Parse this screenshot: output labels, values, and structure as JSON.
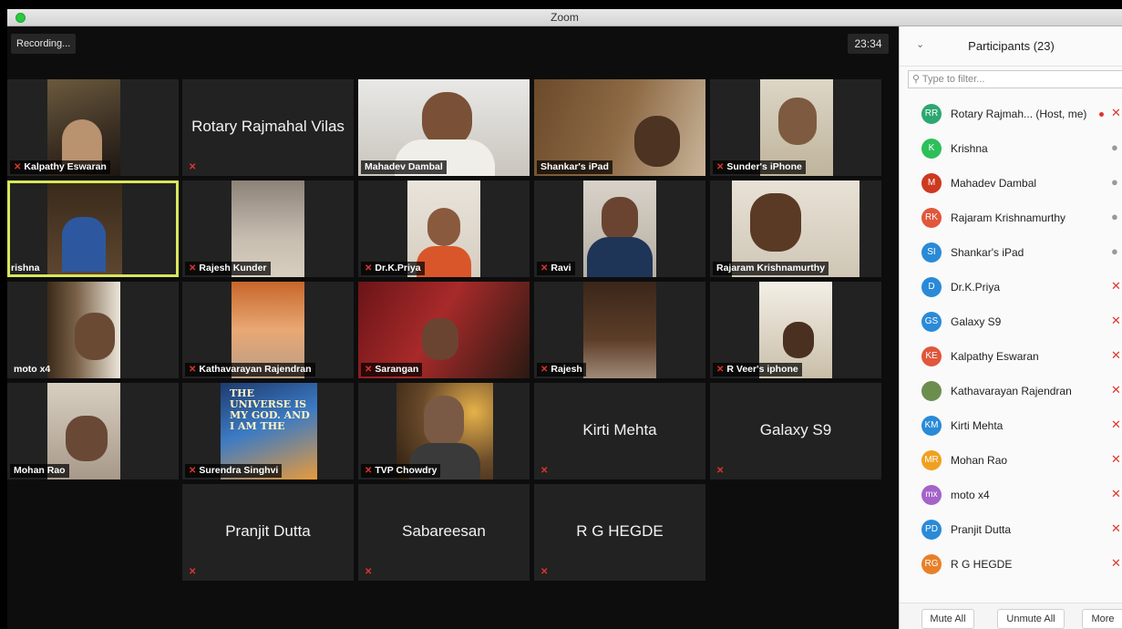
{
  "window": {
    "title": "Zoom"
  },
  "stage": {
    "recording": "Recording...",
    "timer": "23:34"
  },
  "tiles": [
    {
      "name": "Kalpathy Eswaran"
    },
    {
      "name": "Rotary Rajmahal Vilas"
    },
    {
      "name": "Mahadev Dambal"
    },
    {
      "name": "Shankar's iPad"
    },
    {
      "name": "Sunder's iPhone"
    },
    {
      "name": "rishna"
    },
    {
      "name": "Rajesh Kunder"
    },
    {
      "name": "Dr.K.Priya"
    },
    {
      "name": "Ravi"
    },
    {
      "name": "Rajaram Krishnamurthy"
    },
    {
      "name": "moto x4"
    },
    {
      "name": "Kathavarayan Rajendran"
    },
    {
      "name": "Sarangan"
    },
    {
      "name": "Rajesh"
    },
    {
      "name": "R Veer's iphone"
    },
    {
      "name": "Mohan Rao"
    },
    {
      "name": "Surendra Singhvi"
    },
    {
      "name": "TVP Chowdry"
    },
    {
      "name": "Kirti Mehta"
    },
    {
      "name": "Galaxy S9"
    },
    {
      "name": "Pranjit Dutta"
    },
    {
      "name": "Sabareesan"
    },
    {
      "name": "R G HEGDE"
    }
  ],
  "poster_text": "THE UNIVERSE IS MY GOD. AND I AM THE",
  "panel": {
    "title": "Participants (23)",
    "filter_placeholder": "Type to filter...",
    "participants": [
      {
        "initials": "RR",
        "name": "Rotary Rajmah...  (Host, me)",
        "color": "#2da771",
        "mic": "muted"
      },
      {
        "initials": "K",
        "name": "Krishna",
        "color": "#2dbf5a",
        "mic": "on"
      },
      {
        "initials": "M",
        "name": "Mahadev Dambal",
        "color": "#cc3a1f",
        "mic": "on"
      },
      {
        "initials": "RK",
        "name": "Rajaram Krishnamurthy",
        "color": "#e0573b",
        "mic": "on"
      },
      {
        "initials": "SI",
        "name": "Shankar's iPad",
        "color": "#2a8ad7",
        "mic": "on"
      },
      {
        "initials": "D",
        "name": "Dr.K.Priya",
        "color": "#2a8ad7",
        "mic": "muted"
      },
      {
        "initials": "GS",
        "name": "Galaxy S9",
        "color": "#2a8ad7",
        "mic": "muted"
      },
      {
        "initials": "KE",
        "name": "Kalpathy Eswaran",
        "color": "#e0573b",
        "mic": "muted"
      },
      {
        "initials": "",
        "name": "Kathavarayan Rajendran",
        "color": "#6b8e4e",
        "mic": "muted"
      },
      {
        "initials": "KM",
        "name": "Kirti Mehta",
        "color": "#2a8ad7",
        "mic": "muted"
      },
      {
        "initials": "MR",
        "name": "Mohan Rao",
        "color": "#f0a020",
        "mic": "muted"
      },
      {
        "initials": "mx",
        "name": "moto x4",
        "color": "#a463c9",
        "mic": "muted"
      },
      {
        "initials": "PD",
        "name": "Pranjit Dutta",
        "color": "#2a8ad7",
        "mic": "muted"
      },
      {
        "initials": "RG",
        "name": "R G HEGDE",
        "color": "#e8802a",
        "mic": "muted"
      }
    ],
    "buttons": {
      "mute_all": "Mute All",
      "unmute_all": "Unmute All",
      "more": "More"
    }
  },
  "colors": {
    "accent_selected": "#d9e65c",
    "muted_red": "#e0352b"
  }
}
